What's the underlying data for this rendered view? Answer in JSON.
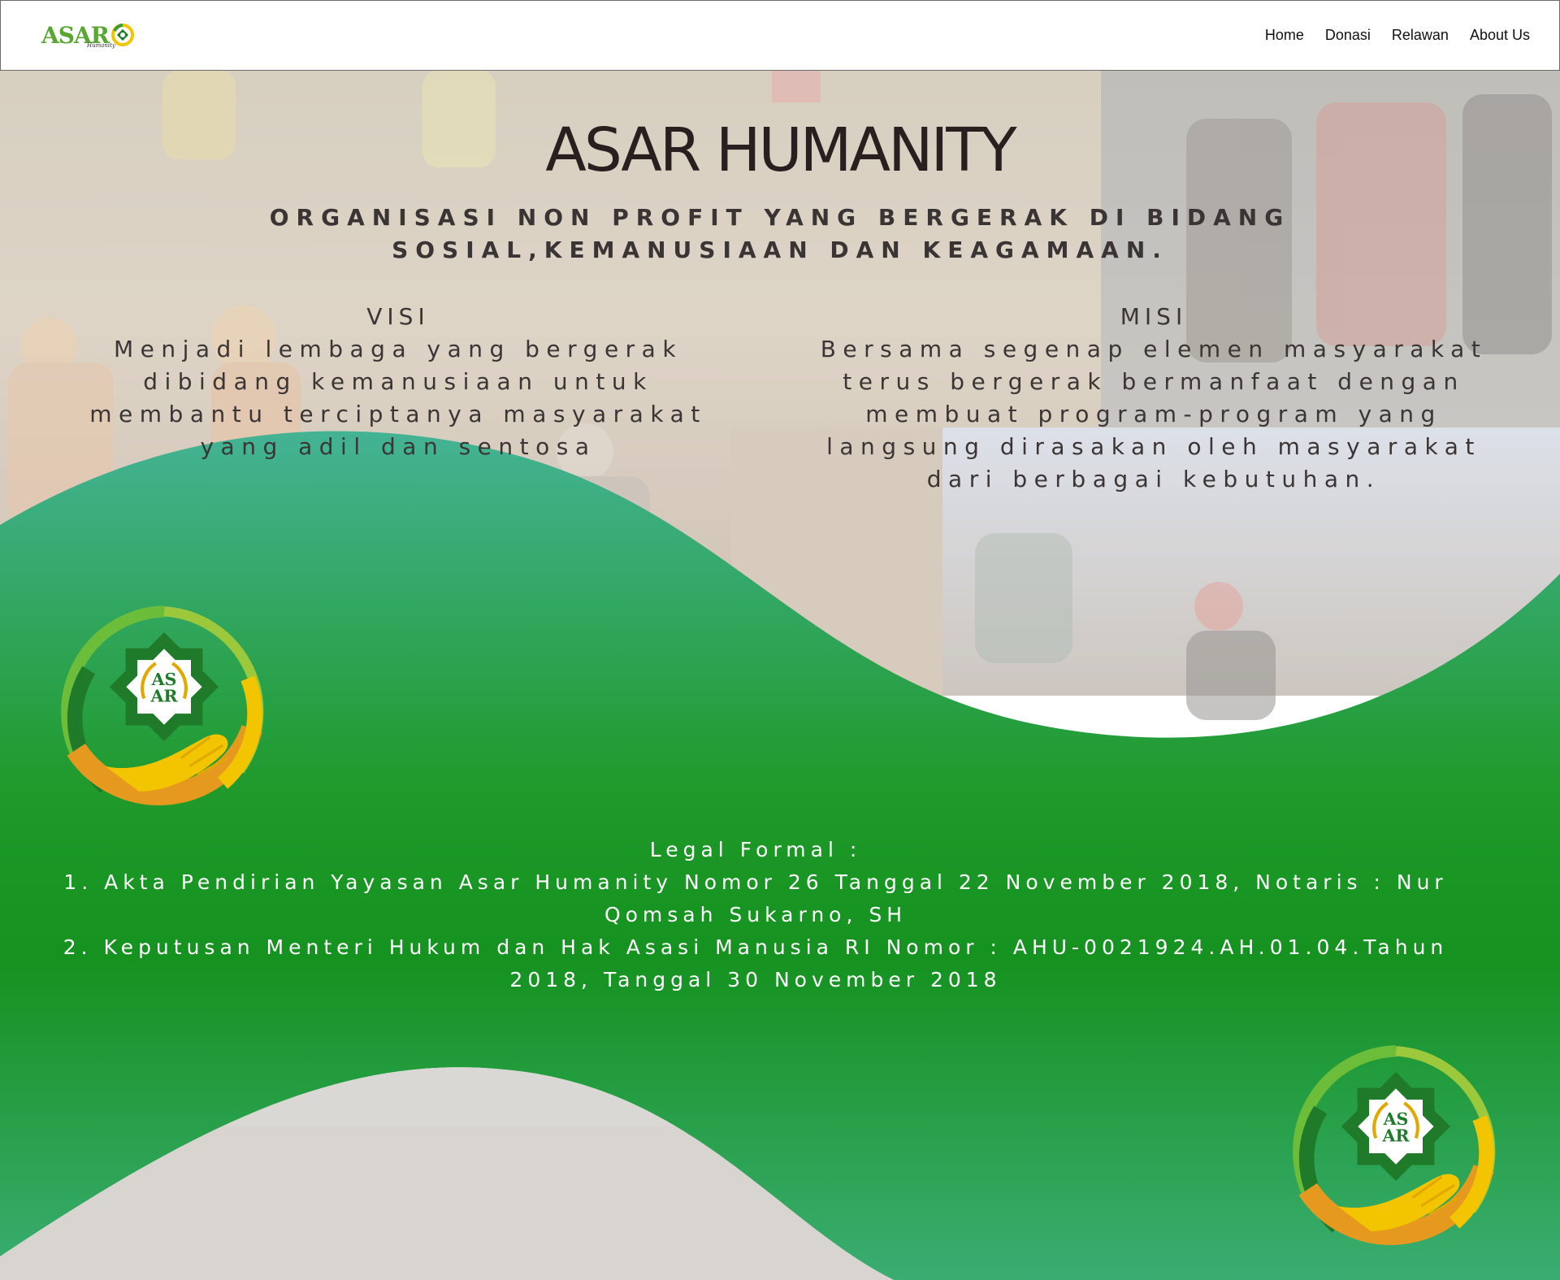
{
  "navbar": {
    "brand_text": "ASAR",
    "brand_sub": "Humanity",
    "links": [
      "Home",
      "Donasi",
      "Relawan",
      "About Us"
    ]
  },
  "hero": {
    "title": "ASAR HUMANITY",
    "tagline": "ORGANISASI NON PROFIT YANG BERGERAK DI BIDANG SOSIAL,KEMANUSIAAN DAN KEAGAMAAN."
  },
  "visi": {
    "heading": "VISI",
    "text": "Menjadi lembaga yang bergerak dibidang kemanusiaan untuk membantu terciptanya masyarakat yang adil dan sentosa"
  },
  "misi": {
    "heading": "MISI",
    "text": "Bersama segenap elemen masyarakat terus bergerak bermanfaat dengan membuat program-program yang langsung dirasakan oleh masyarakat dari berbagai kebutuhan."
  },
  "legal": {
    "heading": "Legal Formal :",
    "item1": "1. Akta Pendirian Yayasan Asar Humanity Nomor 26 Tanggal 22 November 2018, Notaris :  Nur Qomsah Sukarno, SH",
    "item2": "2. Keputusan Menteri Hukum dan Hak Asasi Manusia RI Nomor : AHU-0021924.AH.01.04.Tahun 2018, Tanggal 30 November 2018"
  },
  "logo": {
    "emblem_line1": "AS",
    "emblem_line2": "AR"
  },
  "colors": {
    "brand_green": "#58a733",
    "wave_teal": "#41b08f",
    "wave_green": "#169226",
    "logo_yellow": "#f2c500",
    "logo_orange": "#e59a1f",
    "logo_dark_green": "#1f7a2a"
  }
}
